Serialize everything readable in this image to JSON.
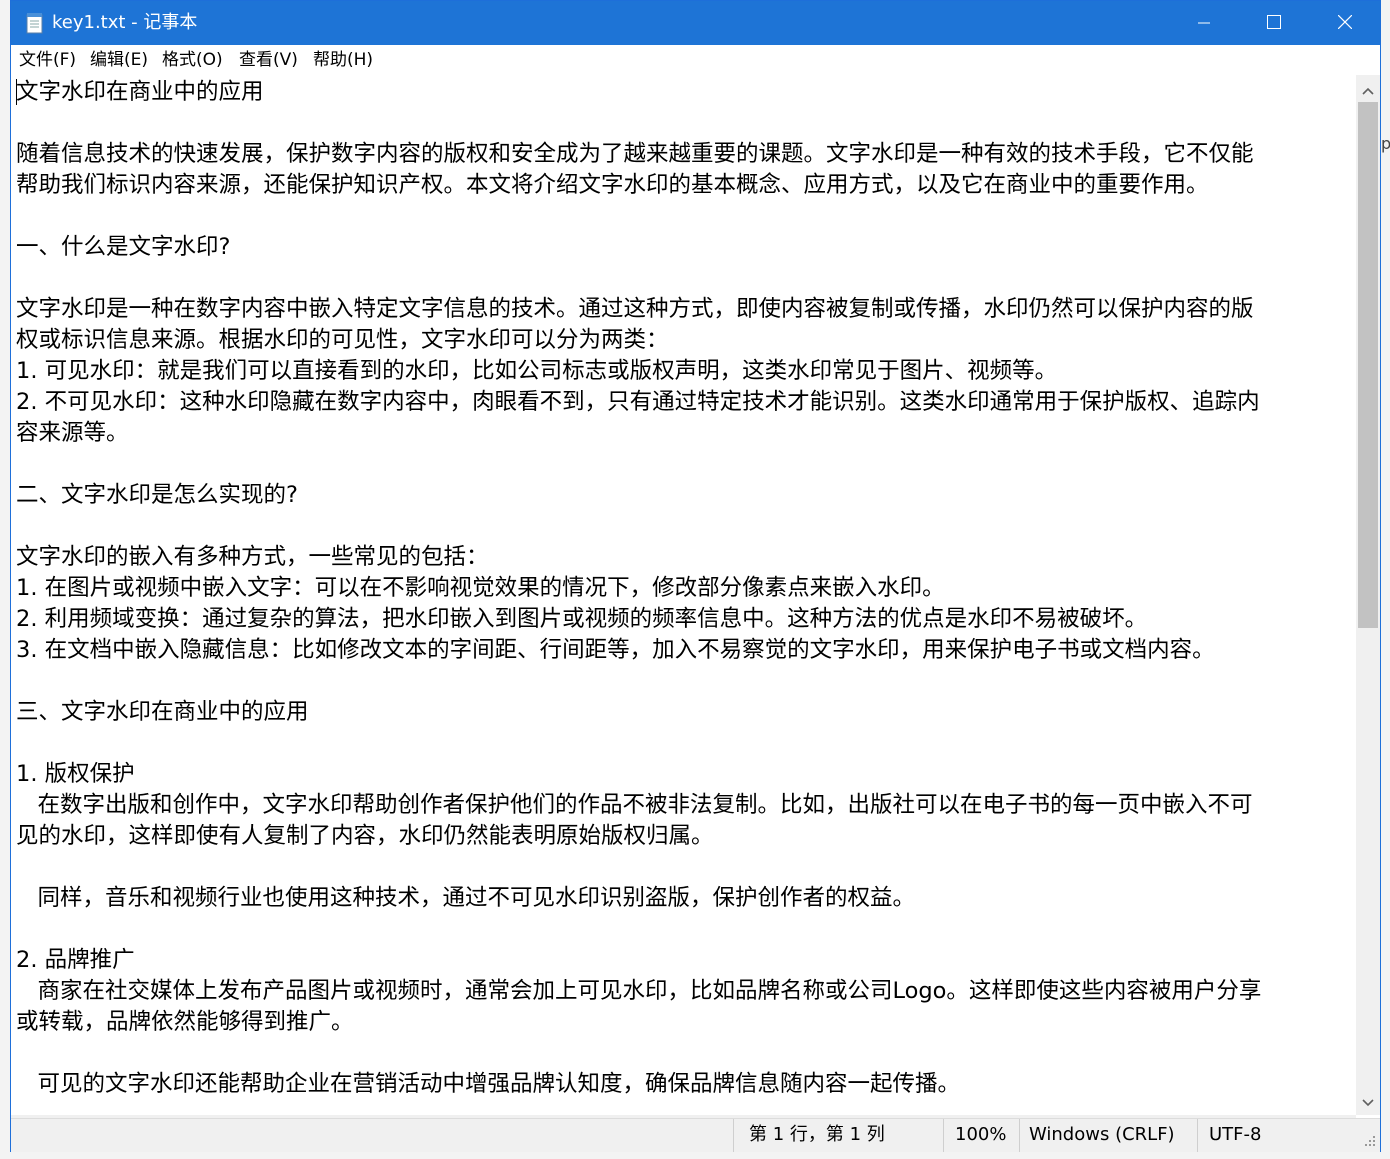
{
  "window": {
    "title": "key1.txt - 记事本",
    "icon": "notepad-icon",
    "controls": [
      "minimize-icon",
      "maximize-icon",
      "close-icon"
    ]
  },
  "menu": {
    "items": [
      "文件(F)",
      "编辑(E)",
      "格式(O)",
      "查看(V)",
      "帮助(H)"
    ]
  },
  "editor": {
    "lines": [
      "文字水印在商业中的应用",
      "",
      "随着信息技术的快速发展，保护数字内容的版权和安全成为了越来越重要的课题。文字水印是一种有效的技术手段，它不仅能",
      "帮助我们标识内容来源，还能保护知识产权。本文将介绍文字水印的基本概念、应用方式，以及它在商业中的重要作用。",
      "",
      "一、什么是文字水印?",
      "",
      "文字水印是一种在数字内容中嵌入特定文字信息的技术。通过这种方式，即使内容被复制或传播，水印仍然可以保护内容的版",
      "权或标识信息来源。根据水印的可见性，文字水印可以分为两类：",
      "1. 可见水印：就是我们可以直接看到的水印，比如公司标志或版权声明，这类水印常见于图片、视频等。",
      "2. 不可见水印：这种水印隐藏在数字内容中，肉眼看不到，只有通过特定技术才能识别。这类水印通常用于保护版权、追踪内",
      "容来源等。",
      "",
      "二、文字水印是怎么实现的?",
      "",
      "文字水印的嵌入有多种方式，一些常见的包括：",
      "1. 在图片或视频中嵌入文字：可以在不影响视觉效果的情况下，修改部分像素点来嵌入水印。",
      "2. 利用频域变换：通过复杂的算法，把水印嵌入到图片或视频的频率信息中。这种方法的优点是水印不易被破坏。",
      "3. 在文档中嵌入隐藏信息：比如修改文本的字间距、行间距等，加入不易察觉的文字水印，用来保护电子书或文档内容。",
      "",
      "三、文字水印在商业中的应用",
      "",
      "1. 版权保护",
      "   在数字出版和创作中，文字水印帮助创作者保护他们的作品不被非法复制。比如，出版社可以在电子书的每一页中嵌入不可",
      "见的水印，这样即使有人复制了内容，水印仍然能表明原始版权归属。",
      "",
      "   同样，音乐和视频行业也使用这种技术，通过不可见水印识别盗版，保护创作者的权益。",
      "",
      "2. 品牌推广",
      "   商家在社交媒体上发布产品图片或视频时，通常会加上可见水印，比如品牌名称或公司Logo。这样即使这些内容被用户分享",
      "或转载，品牌依然能够得到推广。",
      "",
      "   可见的文字水印还能帮助企业在营销活动中增强品牌认知度，确保品牌信息随内容一起传播。"
    ]
  },
  "status": {
    "position": "第 1 行，第 1 列",
    "zoom": "100%",
    "line_ending": "Windows (CRLF)",
    "encoding": "UTF-8"
  },
  "colors": {
    "titlebar": "#1e74d6",
    "scroll_thumb": "#c2c2c2",
    "statusbar": "#f0f0f0"
  }
}
